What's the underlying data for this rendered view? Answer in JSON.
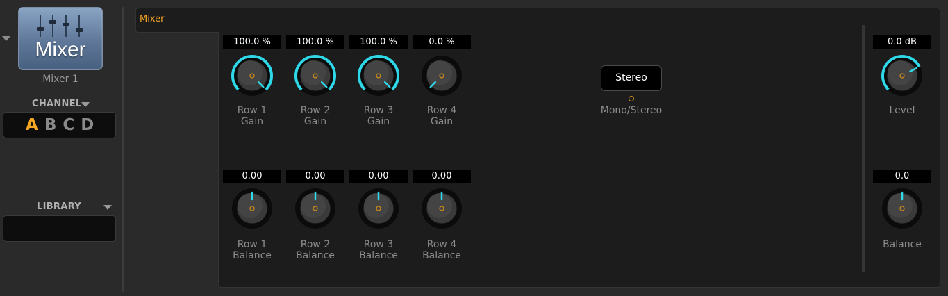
{
  "module": {
    "icon_title": "Mixer",
    "name": "Mixer 1"
  },
  "channel": {
    "label": "CHANNEL",
    "options": [
      "A",
      "B",
      "C",
      "D"
    ],
    "active": "A"
  },
  "library": {
    "label": "LIBRARY",
    "value": ""
  },
  "tab": {
    "label": "Mixer"
  },
  "gain_knobs": [
    {
      "value": "100.0 %",
      "line1": "Row 1",
      "line2": "Gain",
      "level": 1.0
    },
    {
      "value": "100.0 %",
      "line1": "Row 2",
      "line2": "Gain",
      "level": 1.0
    },
    {
      "value": "100.0 %",
      "line1": "Row 3",
      "line2": "Gain",
      "level": 1.0
    },
    {
      "value": "0.0 %",
      "line1": "Row 4",
      "line2": "Gain",
      "level": 0.0
    }
  ],
  "balance_knobs": [
    {
      "value": "0.00",
      "line1": "Row 1",
      "line2": "Balance",
      "level": 0.5
    },
    {
      "value": "0.00",
      "line1": "Row 2",
      "line2": "Balance",
      "level": 0.5
    },
    {
      "value": "0.00",
      "line1": "Row 3",
      "line2": "Balance",
      "level": 0.5
    },
    {
      "value": "0.00",
      "line1": "Row 4",
      "line2": "Balance",
      "level": 0.5
    }
  ],
  "mono_stereo": {
    "button": "Stereo",
    "label": "Mono/Stereo"
  },
  "level": {
    "value": "0.0 dB",
    "label": "Level",
    "level": 0.73
  },
  "balance": {
    "value": "0.0",
    "label": "Balance",
    "level": 0.5
  },
  "colors": {
    "accent": "#f5a623",
    "arc": "#2fd8e8",
    "panel": "#1c1c1c"
  }
}
